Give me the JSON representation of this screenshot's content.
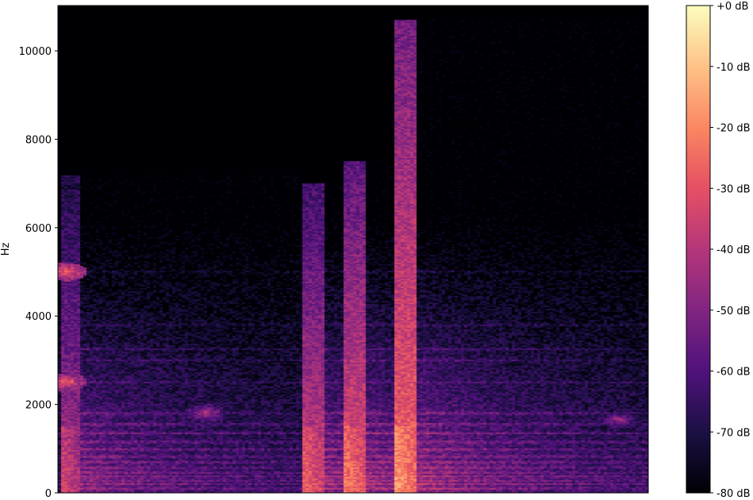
{
  "chart_data": {
    "type": "heatmap",
    "title": "",
    "xlabel": "",
    "ylabel": "Hz",
    "ylim": [
      0,
      11025
    ],
    "yticks": [
      0,
      2000,
      4000,
      6000,
      8000,
      10000
    ],
    "ytick_labels": [
      "0",
      "2000",
      "4000",
      "6000",
      "8000",
      "10000"
    ],
    "xticks": [],
    "colormap": "magma",
    "colorbar": {
      "range_db": [
        -80,
        0
      ],
      "ticks": [
        0,
        -10,
        -20,
        -30,
        -40,
        -50,
        -60,
        -70,
        -80
      ],
      "tick_labels": [
        "+0 dB",
        "-10 dB",
        "-20 dB",
        "-30 dB",
        "-40 dB",
        "-50 dB",
        "-60 dB",
        "-70 dB",
        "-80 dB"
      ]
    },
    "time_extent": [
      0,
      1
    ],
    "features": {
      "onsets": [
        {
          "t": 0.01,
          "strength": -42,
          "top_hz": 7200
        },
        {
          "t": 0.42,
          "strength": -35,
          "top_hz": 7000
        },
        {
          "t": 0.49,
          "strength": -30,
          "top_hz": 7500
        },
        {
          "t": 0.575,
          "strength": -25,
          "top_hz": 10700
        }
      ],
      "base_level_db": -84,
      "decay": 0.24,
      "harmonics_hz": [
        100,
        200,
        280,
        370,
        460,
        570,
        690,
        820,
        980,
        1150,
        1350,
        1550,
        1800,
        2500,
        3000,
        3250,
        3800,
        5000
      ],
      "noise_edge_hz": 6300,
      "hot_spots": [
        {
          "t": 0.015,
          "hz": 5000,
          "db": -28
        },
        {
          "t": 0.015,
          "hz": 2500,
          "db": -30
        },
        {
          "t": 0.25,
          "hz": 1800,
          "db": -44
        },
        {
          "t": 0.95,
          "hz": 1650,
          "db": -48
        }
      ]
    }
  }
}
